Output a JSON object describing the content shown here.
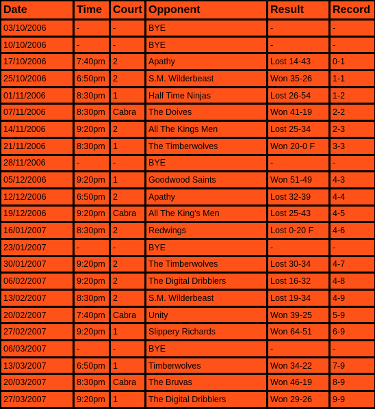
{
  "colors": {
    "cell_background": "#FF5219",
    "grid_lines": "#000000",
    "text": "#000000"
  },
  "table": {
    "headers": [
      "Date",
      "Time",
      "Court",
      "Opponent",
      "Result",
      "Record"
    ],
    "rows": [
      [
        "03/10/2006",
        "-",
        "-",
        "BYE",
        "-",
        "-"
      ],
      [
        "10/10/2006",
        "-",
        "-",
        "BYE",
        "-",
        "-"
      ],
      [
        "17/10/2006",
        "7:40pm",
        "2",
        "Apathy",
        "Lost 14-43",
        "0-1"
      ],
      [
        "25/10/2006",
        "6:50pm",
        "2",
        "S.M. Wilderbeast",
        "Won 35-26",
        "1-1"
      ],
      [
        "01/11/2006",
        "8:30pm",
        "1",
        "Half Time Ninjas",
        "Lost 26-54",
        "1-2"
      ],
      [
        "07/11/2006",
        "8:30pm",
        "Cabra",
        "The Doives",
        "Won 41-19",
        "2-2"
      ],
      [
        "14/11/2006",
        "9:20pm",
        "2",
        "All The Kings Men",
        "Lost 25-34",
        "2-3"
      ],
      [
        "21/11/2006",
        "8:30pm",
        "1",
        "The Timberwolves",
        "Won 20-0 F",
        "3-3"
      ],
      [
        "28/11/2006",
        "-",
        "-",
        "BYE",
        "-",
        "-"
      ],
      [
        "05/12/2006",
        "9:20pm",
        "1",
        "Goodwood Saints",
        "Won 51-49",
        "4-3"
      ],
      [
        "12/12/2006",
        "6:50pm",
        "2",
        "Apathy",
        "Lost 32-39",
        "4-4"
      ],
      [
        "19/12/2006",
        "9:20pm",
        "Cabra",
        "All The King's Men",
        "Lost 25-43",
        "4-5"
      ],
      [
        "16/01/2007",
        "8:30pm",
        "2",
        "Redwings",
        "Lost 0-20 F",
        "4-6"
      ],
      [
        "23/01/2007",
        "-",
        "-",
        "BYE",
        "-",
        "-"
      ],
      [
        "30/01/2007",
        "9:20pm",
        "2",
        "The Timberwolves",
        "Lost 30-34",
        "4-7"
      ],
      [
        "06/02/2007",
        "9:20pm",
        "2",
        "The Digital Dribblers",
        "Lost 16-32",
        "4-8"
      ],
      [
        "13/02/2007",
        "8:30pm",
        "2",
        "S.M. Wilderbeast",
        "Lost 19-34",
        "4-9"
      ],
      [
        "20/02/2007",
        "7:40pm",
        "Cabra",
        "Unity",
        "Won 39-25",
        "5-9"
      ],
      [
        "27/02/2007",
        "9:20pm",
        "1",
        "Slippery Richards",
        "Won 64-51",
        "6-9"
      ],
      [
        "06/03/2007",
        "-",
        "-",
        "BYE",
        "-",
        "-"
      ],
      [
        "13/03/2007",
        "6:50pm",
        "1",
        "Timberwolves",
        "Won 34-22",
        "7-9"
      ],
      [
        "20/03/2007",
        "8:30pm",
        "Cabra",
        "The Bruvas",
        "Won 46-19",
        "8-9"
      ],
      [
        "27/03/2007",
        "9:20pm",
        "1",
        "The Digital Dribblers",
        "Won 29-26",
        "9-9"
      ]
    ]
  }
}
